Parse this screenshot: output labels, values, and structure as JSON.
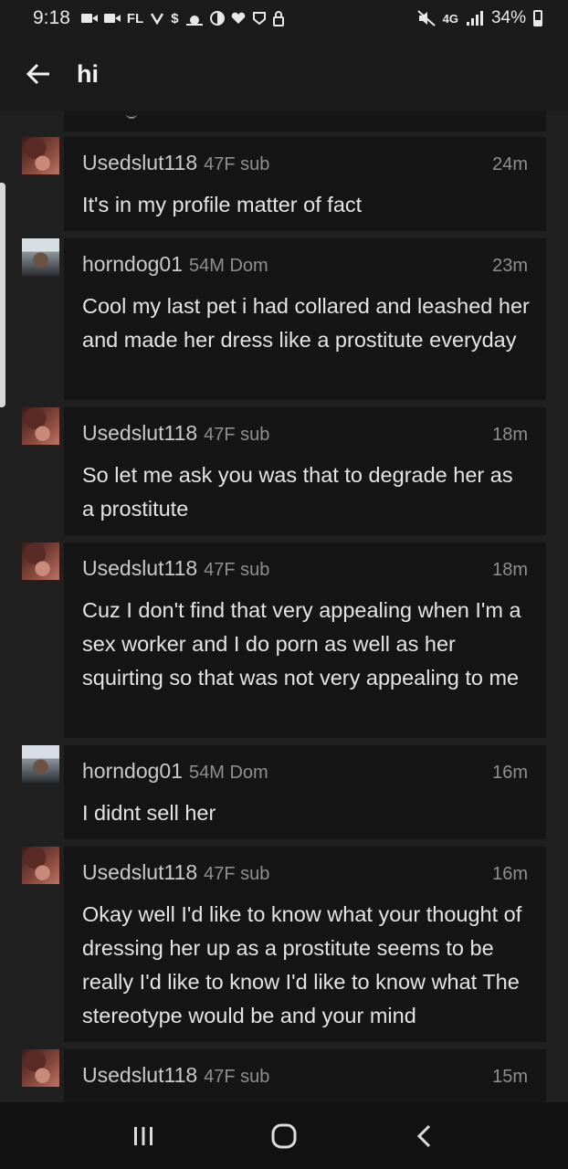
{
  "status_bar": {
    "time": "9:18",
    "carrier_text": "FL",
    "network": "4G",
    "battery": "34%"
  },
  "header": {
    "title": "hi"
  },
  "messages": [
    {
      "username": "Usedslut118",
      "tag": "47F sub",
      "time": "24m",
      "text": "It's in my profile matter of fact",
      "avatar": "female-avatar"
    },
    {
      "username": "horndog01",
      "tag": "54M Dom",
      "time": "23m",
      "text": "Cool my last pet i had collared and leashed her and made her dress like a prostitute everyday",
      "avatar": "male-avatar"
    },
    {
      "username": "Usedslut118",
      "tag": "47F sub",
      "time": "18m",
      "text": "So let me ask you was that to degrade her as a prostitute",
      "avatar": "female-avatar"
    },
    {
      "username": "Usedslut118",
      "tag": "47F sub",
      "time": "18m",
      "text": "Cuz I don't find that very appealing when I'm a sex worker and I do porn as well as her squirting so that was not very appealing to me",
      "avatar": "female-avatar"
    },
    {
      "username": "horndog01",
      "tag": "54M Dom",
      "time": "16m",
      "text": "I didnt sell her",
      "avatar": "male-avatar"
    },
    {
      "username": "Usedslut118",
      "tag": "47F sub",
      "time": "16m",
      "text": "Okay well I'd like to know what your thought of dressing her up as a prostitute seems to be really I'd like to know I'd like to know what The stereotype would be and your mind",
      "avatar": "female-avatar"
    },
    {
      "username": "Usedslut118",
      "tag": "47F sub",
      "time": "15m",
      "text": "",
      "avatar": "female-avatar"
    }
  ],
  "nav": {
    "recents": "recent-apps-icon",
    "home": "home-icon",
    "back": "back-icon"
  }
}
